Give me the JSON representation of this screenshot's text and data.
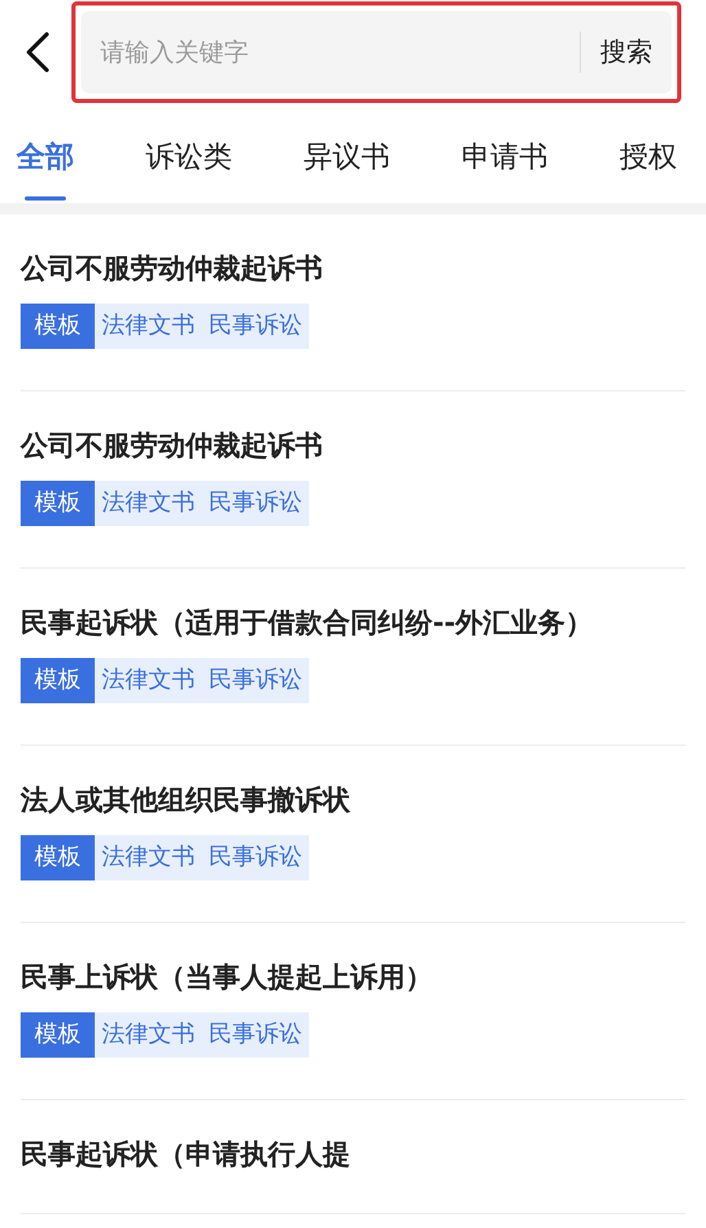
{
  "search": {
    "placeholder": "请输入关键字",
    "button": "搜索"
  },
  "tabs": [
    {
      "label": "全部",
      "selected": true
    },
    {
      "label": "诉讼类",
      "selected": false
    },
    {
      "label": "异议书",
      "selected": false
    },
    {
      "label": "申请书",
      "selected": false
    },
    {
      "label": "授权",
      "selected": false
    }
  ],
  "items": [
    {
      "title": "公司不服劳动仲裁起诉书",
      "tags": [
        {
          "kind": "primary",
          "label": "模板"
        },
        {
          "kind": "plain",
          "label": "法律文书"
        },
        {
          "kind": "plain",
          "label": "民事诉讼"
        }
      ]
    },
    {
      "title": "公司不服劳动仲裁起诉书",
      "tags": [
        {
          "kind": "primary",
          "label": "模板"
        },
        {
          "kind": "plain",
          "label": "法律文书"
        },
        {
          "kind": "plain",
          "label": "民事诉讼"
        }
      ]
    },
    {
      "title": "民事起诉状（适用于借款合同纠纷--外汇业务）",
      "tags": [
        {
          "kind": "primary",
          "label": "模板"
        },
        {
          "kind": "plain",
          "label": "法律文书"
        },
        {
          "kind": "plain",
          "label": "民事诉讼"
        }
      ]
    },
    {
      "title": "法人或其他组织民事撤诉状",
      "tags": [
        {
          "kind": "primary",
          "label": "模板"
        },
        {
          "kind": "plain",
          "label": "法律文书"
        },
        {
          "kind": "plain",
          "label": "民事诉讼"
        }
      ]
    },
    {
      "title": "民事上诉状（当事人提起上诉用）",
      "tags": [
        {
          "kind": "primary",
          "label": "模板"
        },
        {
          "kind": "plain",
          "label": "法律文书"
        },
        {
          "kind": "plain",
          "label": "民事诉讼"
        }
      ]
    },
    {
      "title": "民事起诉状（申请执行人提"
    }
  ]
}
